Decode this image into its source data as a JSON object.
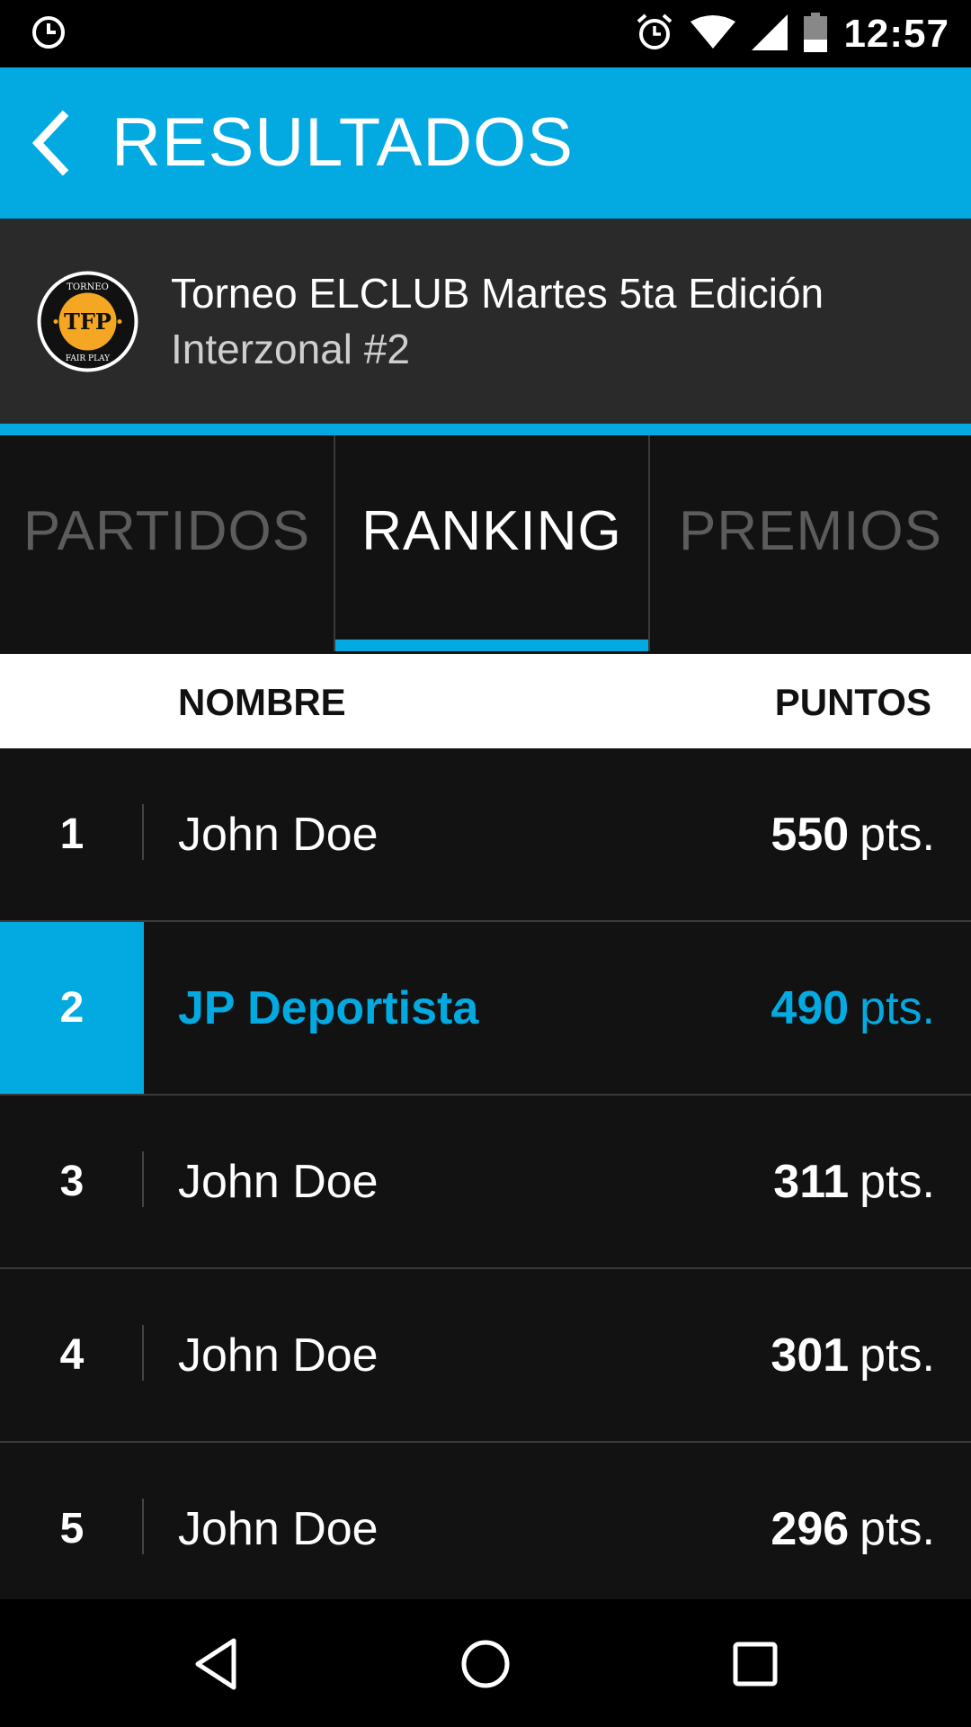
{
  "status_bar": {
    "time": "12:57"
  },
  "app_bar": {
    "title": "RESULTADOS"
  },
  "tournament": {
    "name": "Torneo ELCLUB Martes 5ta Edición",
    "subtitle": "Interzonal #2",
    "logo": {
      "top": "TORNEO",
      "center": "TFP",
      "bottom": "FAIR PLAY"
    }
  },
  "tabs": [
    {
      "label": "PARTIDOS",
      "active": false
    },
    {
      "label": "RANKING",
      "active": true
    },
    {
      "label": "PREMIOS",
      "active": false
    }
  ],
  "table": {
    "col_name": "NOMBRE",
    "col_points": "PUNTOS",
    "rows": [
      {
        "rank": "1",
        "name": "John Doe",
        "points": "550",
        "unit": "pts."
      },
      {
        "rank": "2",
        "name": "JP Deportista",
        "points": "490",
        "unit": "pts.",
        "highlight": true
      },
      {
        "rank": "3",
        "name": "John Doe",
        "points": "311",
        "unit": "pts."
      },
      {
        "rank": "4",
        "name": "John Doe",
        "points": "301",
        "unit": "pts."
      },
      {
        "rank": "5",
        "name": "John Doe",
        "points": "296",
        "unit": "pts."
      }
    ]
  },
  "colors": {
    "accent": "#03A9E1",
    "background": "#121212",
    "header_dark": "#2A2A2B",
    "logo_yellow": "#F5A623"
  },
  "icons": [
    "clock-icon",
    "alarm-icon",
    "wifi-icon",
    "signal-icon",
    "battery-icon",
    "back-arrow-icon",
    "nav-back-icon",
    "nav-home-icon",
    "nav-recents-icon"
  ]
}
